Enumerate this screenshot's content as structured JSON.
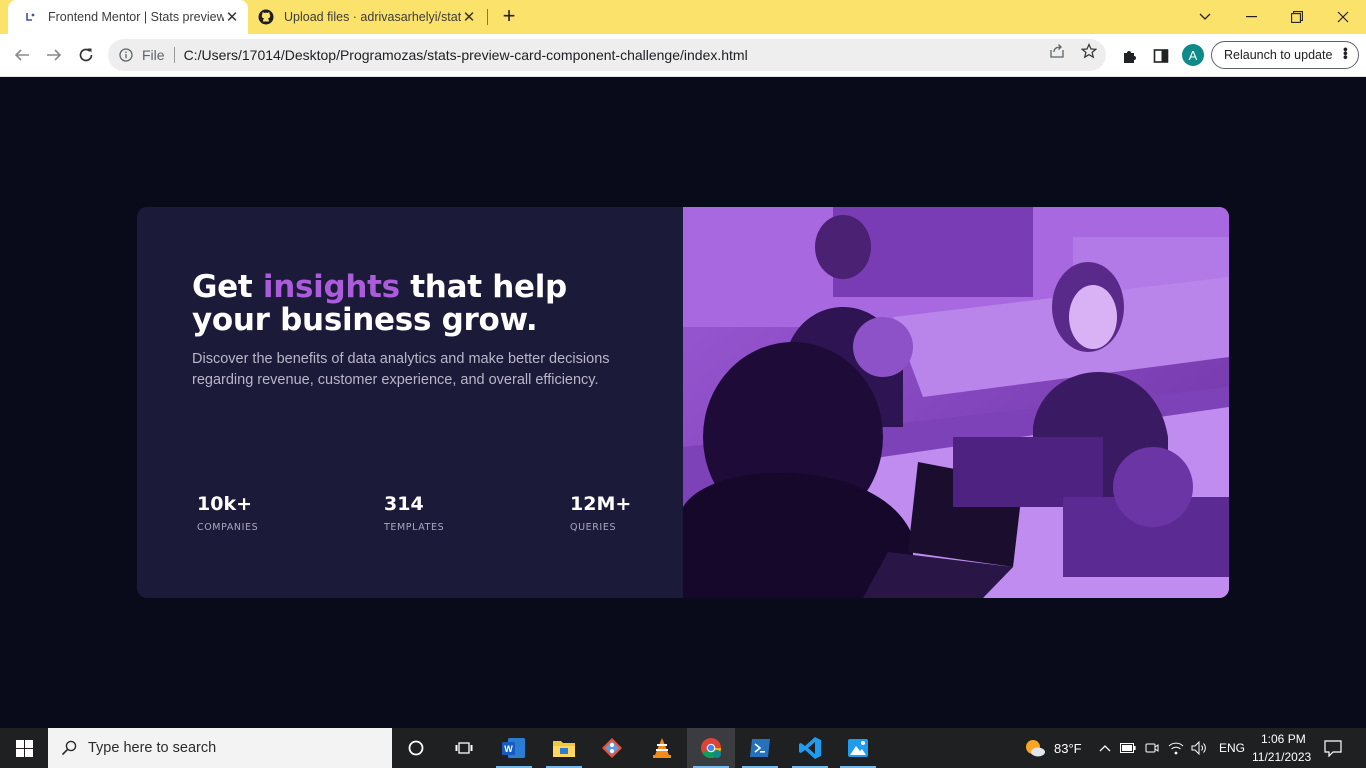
{
  "browser": {
    "tabs": [
      {
        "title": "Frontend Mentor | Stats preview card component",
        "favicon": "frontend-mentor-icon",
        "active": true
      },
      {
        "title": "Upload files · adrivasarhelyi/stats-preview-card-component",
        "favicon": "github-icon",
        "active": false
      }
    ],
    "address": {
      "scheme_label": "File",
      "url": "C:/Users/17014/Desktop/Programozas/stats-preview-card-component-challenge/index.html"
    },
    "profile_initial": "A",
    "relaunch_label": "Relaunch to update",
    "theme_color": "#fbe26b"
  },
  "page": {
    "heading": {
      "before": "Get ",
      "accent": "insights",
      "after": " that help your business grow."
    },
    "description": "Discover the benefits of data analytics and make better decisions regarding revenue, customer experience, and overall efficiency.",
    "stats": [
      {
        "value": "10k+",
        "label": "COMPANIES"
      },
      {
        "value": "314",
        "label": "TEMPLATES"
      },
      {
        "value": "12M+",
        "label": "QUERIES"
      }
    ],
    "colors": {
      "background": "#090b1a",
      "card": "#1c1a39",
      "accent": "#aa5cdb",
      "image_overlay": "#8a4ac6"
    }
  },
  "taskbar": {
    "search_placeholder": "Type here to search",
    "weather": "83°F",
    "language": "ENG",
    "time": "1:06 PM",
    "date": "11/21/2023",
    "apps": [
      "cortana-icon",
      "task-view-icon",
      "word-icon",
      "file-explorer-icon",
      "git-icon",
      "vlc-icon",
      "chrome-icon",
      "powershell-icon",
      "vscode-icon",
      "photos-icon"
    ]
  }
}
